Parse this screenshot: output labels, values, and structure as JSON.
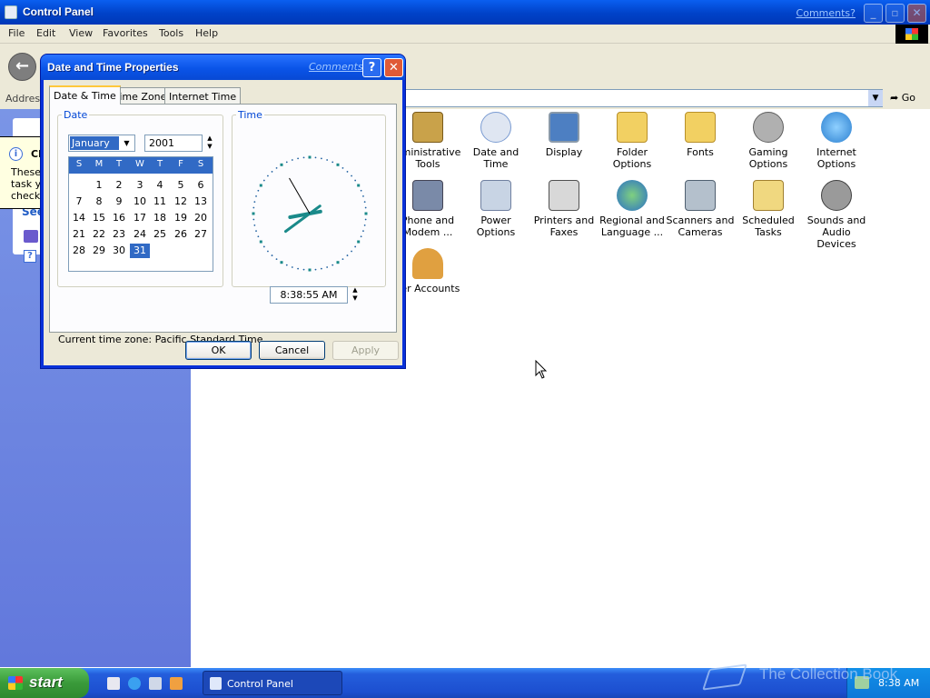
{
  "window": {
    "title": "Control Panel",
    "comments_link": "Comments?",
    "min_glyph": "_",
    "max_glyph": "▫",
    "close_glyph": "✕"
  },
  "menubar": [
    "File",
    "Edit",
    "View",
    "Favorites",
    "Tools",
    "Help"
  ],
  "address": {
    "label": "Address",
    "go_label": "Go"
  },
  "sidebar": {
    "fragment_see": "See"
  },
  "tooltip": {
    "title": "Cl",
    "body_lines": [
      "These",
      "task yo",
      "check t"
    ]
  },
  "items": [
    {
      "label": "dministrative Tools",
      "icon": "administrative-tools-icon",
      "color": "#c9a24a"
    },
    {
      "label": "Date and Time",
      "icon": "date-and-time-icon",
      "color": "#7a9bd2"
    },
    {
      "label": "Display",
      "icon": "display-icon",
      "color": "#4d7fc2"
    },
    {
      "label": "Folder Options",
      "icon": "folder-options-icon",
      "color": "#f2d062"
    },
    {
      "label": "Fonts",
      "icon": "fonts-icon",
      "color": "#f2d062"
    },
    {
      "label": "Gaming Options",
      "icon": "gaming-options-icon",
      "color": "#8c8c8c"
    },
    {
      "label": "Internet Options",
      "icon": "internet-options-icon",
      "color": "#3b8fd8"
    },
    {
      "label": "Phone and Modem ...",
      "icon": "phone-modem-icon",
      "color": "#7a8aa8"
    },
    {
      "label": "Power Options",
      "icon": "power-options-icon",
      "color": "#9aaec8"
    },
    {
      "label": "Printers and Faxes",
      "icon": "printers-faxes-icon",
      "color": "#b8b8b8"
    },
    {
      "label": "Regional and Language ...",
      "icon": "regional-language-icon",
      "color": "#3a7fc8"
    },
    {
      "label": "Scanners and Cameras",
      "icon": "scanners-cameras-icon",
      "color": "#9aa8b8"
    },
    {
      "label": "Scheduled Tasks",
      "icon": "scheduled-tasks-icon",
      "color": "#e8c060"
    },
    {
      "label": "Sounds and Audio Devices",
      "icon": "sounds-audio-icon",
      "color": "#8a8a8a"
    },
    {
      "label": "ser Accounts",
      "icon": "user-accounts-icon",
      "color": "#e0a040"
    }
  ],
  "dialog": {
    "title": "Date and Time Properties",
    "comments_link": "Comments?",
    "help_glyph": "?",
    "close_glyph": "✕",
    "tabs": [
      "Date & Time",
      "Time Zone",
      "Internet Time"
    ],
    "date_legend": "Date",
    "time_legend": "Time",
    "month": "January",
    "year": "2001",
    "weekdays": [
      "S",
      "M",
      "T",
      "W",
      "T",
      "F",
      "S"
    ],
    "first_weekday_index": 1,
    "days_in_month": 31,
    "selected_day": 31,
    "time": "8:38:55 AM",
    "clock": {
      "hour": 8,
      "minute": 38,
      "second": 55
    },
    "timezone_text": "Current time zone:  Pacific Standard Time",
    "buttons": {
      "ok": "OK",
      "cancel": "Cancel",
      "apply": "Apply"
    }
  },
  "taskbar": {
    "start_label": "start",
    "task_label": "Control Panel",
    "clock": "8:38 AM",
    "watermark": "The Collection Book"
  },
  "colors": {
    "titlebar": "#0a54e8",
    "sidebar": "#6f88e2",
    "selection": "#316ac5",
    "taskbar": "#245edc"
  }
}
